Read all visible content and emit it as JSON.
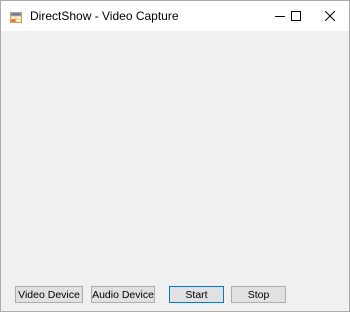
{
  "window": {
    "title": "DirectShow - Video Capture"
  },
  "caption_buttons": {
    "minimize_icon": "minimize-icon",
    "maximize_icon": "maximize-icon",
    "close_icon": "close-icon"
  },
  "buttons": {
    "video_device": "Video Device",
    "audio_device": "Audio Device",
    "start": "Start",
    "stop": "Stop"
  },
  "colors": {
    "client_background": "#f0f0f0",
    "default_button_border": "#0078d7"
  }
}
